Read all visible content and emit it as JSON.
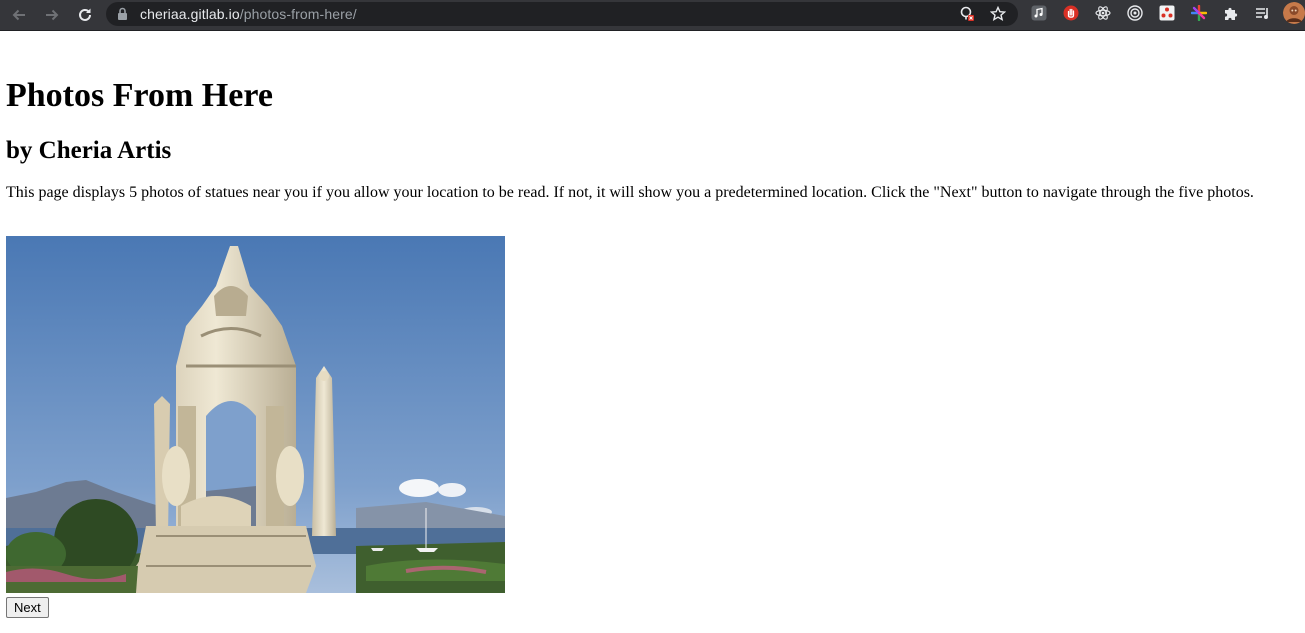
{
  "browser": {
    "url_host": "cheriaa.gitlab.io",
    "url_path": "/photos-from-here/",
    "icons": [
      "back-arrow-icon",
      "forward-arrow-icon",
      "reload-icon",
      "lock-icon",
      "site-blocked-icon",
      "bookmark-star-icon",
      "music-extension-icon",
      "stop-hand-extension-icon",
      "react-devtools-icon",
      "target-extension-icon",
      "grid-extension-icon",
      "pinwheel-extension-icon",
      "puzzle-extensions-icon",
      "reading-list-icon",
      "profile-avatar"
    ]
  },
  "page": {
    "title": "Photos From Here",
    "subtitle": "by Cheria Artis",
    "description": "This page displays 5 photos of statues near you if you allow your location to be read. If not, it will show you a predetermined location. Click the \"Next\" button to navigate through the five photos.",
    "next_label": "Next"
  }
}
